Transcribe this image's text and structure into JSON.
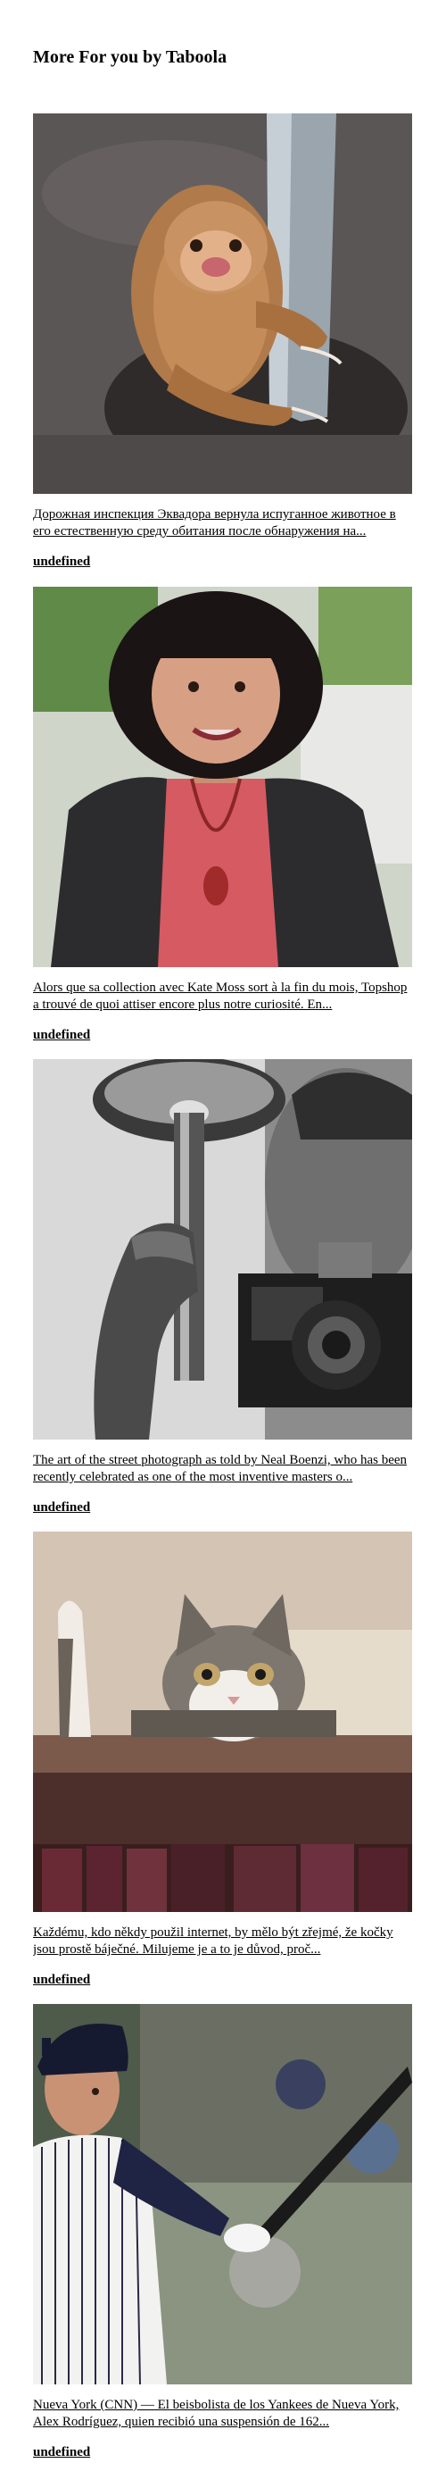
{
  "widget": {
    "title": "More For you by Taboola"
  },
  "items": [
    {
      "image_subject": "sloth hugging a metal pole",
      "caption": "Дорожная инспекция Эквадора вернула испуганное животное в его естественную среду обитания после обнаружения на...",
      "branding": "undefined"
    },
    {
      "image_subject": "woman with black bangs in pink shirt and black jacket",
      "caption": "Alors que sa collection avec Kate Moss sort à la fin du mois, Topshop a trouvé de quoi attiser encore plus notre curiosité. En...",
      "branding": "undefined"
    },
    {
      "image_subject": "black and white photographer holding vintage camera with flash",
      "caption": "The art of the street photograph as told by Neal Boenzi, who has been recently celebrated as one of the most inventive masters o...",
      "branding": "undefined"
    },
    {
      "image_subject": "cat raising paw in front of bookshelf",
      "caption": "Každému, kdo někdy použil internet, by mělo být zřejmé, že kočky jsou prostě báječné. Milujeme je a to je důvod, proč...",
      "branding": "undefined"
    },
    {
      "image_subject": "Yankees baseball player holding bat",
      "caption": "Nueva York (CNN) — El beisbolista de los Yankees de Nueva York, Alex Rodríguez, quien recibió una suspensión de 162...",
      "branding": "undefined"
    }
  ]
}
